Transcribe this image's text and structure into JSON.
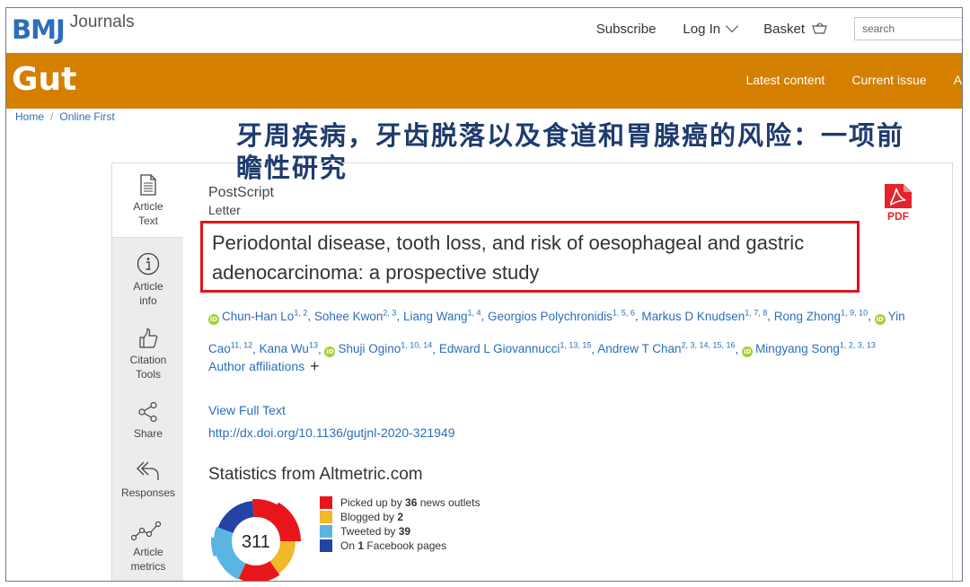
{
  "header": {
    "logo_main": "BMJ",
    "logo_sub": "Journals",
    "subscribe": "Subscribe",
    "login": "Log In",
    "basket": "Basket",
    "search_placeholder": "search"
  },
  "brand": {
    "title": "Gut",
    "nav": [
      "Latest content",
      "Current issue",
      "A"
    ]
  },
  "breadcrumb": [
    "Home",
    "Online First"
  ],
  "overlay_title": "牙周疾病，牙齿脱落以及食道和胃腺癌的风险：一项前瞻性研究",
  "rail": [
    {
      "label": "Article Text",
      "icon": "document-icon"
    },
    {
      "label": "Article info",
      "icon": "info-icon"
    },
    {
      "label": "Citation Tools",
      "icon": "thumbs-up-icon"
    },
    {
      "label": "Share",
      "icon": "share-icon"
    },
    {
      "label": "Responses",
      "icon": "reply-icon"
    },
    {
      "label": "Article metrics",
      "icon": "metrics-icon"
    }
  ],
  "article": {
    "section": "PostScript",
    "type": "Letter",
    "pdf_label": "PDF",
    "title": "Periodontal disease, tooth loss, and risk of oesophageal and gastric adenocarcinoma: a prospective study",
    "authors": [
      {
        "name": "Chun-Han Lo",
        "sup": "1, 2",
        "orcid": true
      },
      {
        "name": "Sohee Kwon",
        "sup": "2, 3",
        "orcid": false
      },
      {
        "name": "Liang Wang",
        "sup": "1, 4",
        "orcid": false
      },
      {
        "name": "Georgios Polychronidis",
        "sup": "1, 5, 6",
        "orcid": false
      },
      {
        "name": "Markus D Knudsen",
        "sup": "1, 7, 8",
        "orcid": false
      },
      {
        "name": "Rong Zhong",
        "sup": "1, 9, 10",
        "orcid": false
      },
      {
        "name": "Yin Cao",
        "sup": "11, 12",
        "orcid": true
      },
      {
        "name": "Kana Wu",
        "sup": "13",
        "orcid": false
      },
      {
        "name": "Shuji Ogino",
        "sup": "1, 10, 14",
        "orcid": true
      },
      {
        "name": "Edward L Giovannucci",
        "sup": "1, 13, 15",
        "orcid": false
      },
      {
        "name": "Andrew T Chan",
        "sup": "2, 3, 14, 15, 16",
        "orcid": false
      },
      {
        "name": "Mingyang Song",
        "sup": "1, 2, 3, 13",
        "orcid": true
      }
    ],
    "affiliations_label": "Author affiliations",
    "view_full_text": "View Full Text",
    "doi": "http://dx.doi.org/10.1136/gutjnl-2020-321949"
  },
  "altmetric": {
    "heading": "Statistics from Altmetric.com",
    "score": "311",
    "items": [
      {
        "prefix": "Picked up by ",
        "count": "36",
        "suffix": " news outlets",
        "color": "#e8161b"
      },
      {
        "prefix": "Blogged by ",
        "count": "2",
        "suffix": "",
        "color": "#f1b827"
      },
      {
        "prefix": "Tweeted by ",
        "count": "39",
        "suffix": "",
        "color": "#5bb5e3"
      },
      {
        "prefix": "On ",
        "count": "1",
        "suffix": " Facebook pages",
        "color": "#2443a3"
      }
    ]
  }
}
